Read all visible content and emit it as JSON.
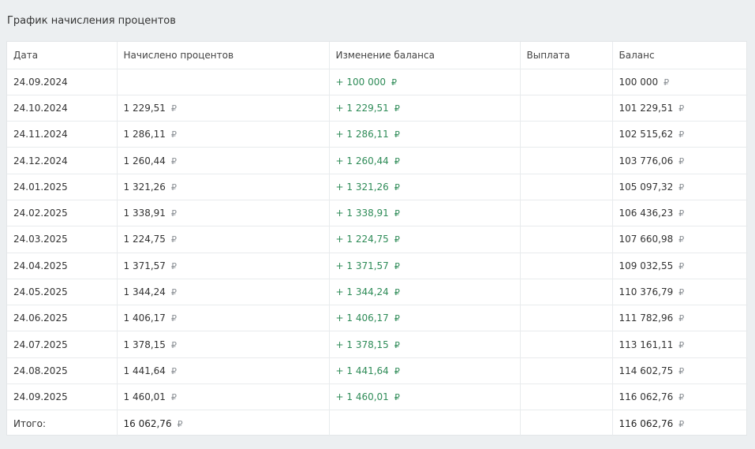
{
  "section": {
    "title": "График начисления процентов"
  },
  "columns": {
    "date": "Дата",
    "interest": "Начислено процентов",
    "change": "Изменение баланса",
    "payout": "Выплата",
    "balance": "Баланс"
  },
  "currency": "₽",
  "rows": [
    {
      "date": "24.09.2024",
      "interest": "",
      "change": "+ 100 000",
      "payout": "",
      "balance": "100 000"
    },
    {
      "date": "24.10.2024",
      "interest": "1 229,51",
      "change": "+ 1 229,51",
      "payout": "",
      "balance": "101 229,51"
    },
    {
      "date": "24.11.2024",
      "interest": "1 286,11",
      "change": "+ 1 286,11",
      "payout": "",
      "balance": "102 515,62"
    },
    {
      "date": "24.12.2024",
      "interest": "1 260,44",
      "change": "+ 1 260,44",
      "payout": "",
      "balance": "103 776,06"
    },
    {
      "date": "24.01.2025",
      "interest": "1 321,26",
      "change": "+ 1 321,26",
      "payout": "",
      "balance": "105 097,32"
    },
    {
      "date": "24.02.2025",
      "interest": "1 338,91",
      "change": "+ 1 338,91",
      "payout": "",
      "balance": "106 436,23"
    },
    {
      "date": "24.03.2025",
      "interest": "1 224,75",
      "change": "+ 1 224,75",
      "payout": "",
      "balance": "107 660,98"
    },
    {
      "date": "24.04.2025",
      "interest": "1 371,57",
      "change": "+ 1 371,57",
      "payout": "",
      "balance": "109 032,55"
    },
    {
      "date": "24.05.2025",
      "interest": "1 344,24",
      "change": "+ 1 344,24",
      "payout": "",
      "balance": "110 376,79"
    },
    {
      "date": "24.06.2025",
      "interest": "1 406,17",
      "change": "+ 1 406,17",
      "payout": "",
      "balance": "111 782,96"
    },
    {
      "date": "24.07.2025",
      "interest": "1 378,15",
      "change": "+ 1 378,15",
      "payout": "",
      "balance": "113 161,11"
    },
    {
      "date": "24.08.2025",
      "interest": "1 441,64",
      "change": "+ 1 441,64",
      "payout": "",
      "balance": "114 602,75"
    },
    {
      "date": "24.09.2025",
      "interest": "1 460,01",
      "change": "+ 1 460,01",
      "payout": "",
      "balance": "116 062,76"
    }
  ],
  "total": {
    "label": "Итого:",
    "interest": "16 062,76",
    "balance": "116 062,76"
  },
  "colors": {
    "background": "#eceff1",
    "positive": "#2e8b57",
    "currency_sign": "#8a8f94"
  }
}
